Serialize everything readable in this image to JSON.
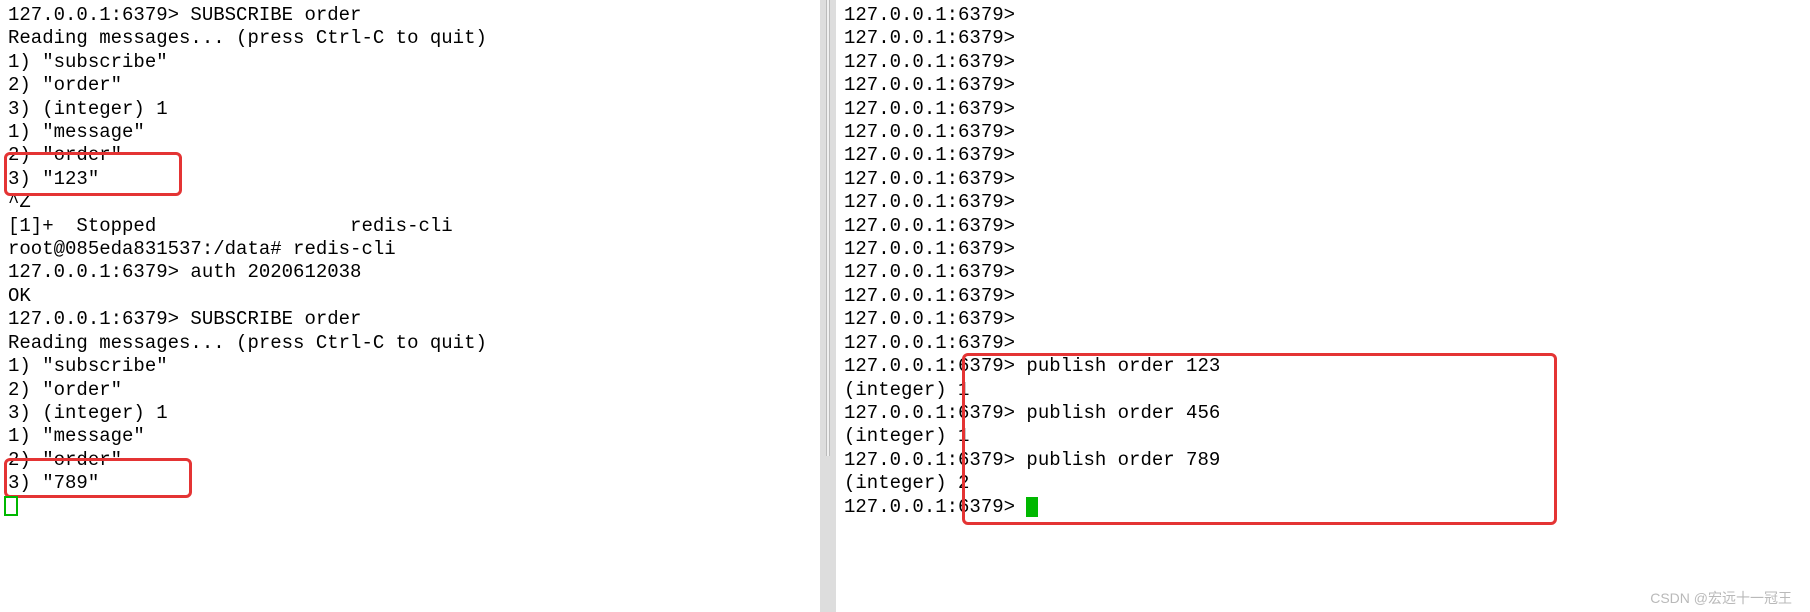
{
  "left": {
    "lines": [
      "127.0.0.1:6379> SUBSCRIBE order",
      "Reading messages... (press Ctrl-C to quit)",
      "1) \"subscribe\"",
      "2) \"order\"",
      "3) (integer) 1",
      "1) \"message\"",
      "2) \"order\"",
      "3) \"123\"",
      "^Z",
      "[1]+  Stopped                 redis-cli",
      "root@085eda831537:/data# redis-cli",
      "127.0.0.1:6379> auth 2020612038",
      "OK",
      "127.0.0.1:6379> SUBSCRIBE order",
      "Reading messages... (press Ctrl-C to quit)",
      "1) \"subscribe\"",
      "2) \"order\"",
      "3) (integer) 1",
      "1) \"message\"",
      "2) \"order\"",
      "3) \"789\""
    ]
  },
  "right": {
    "lines": [
      "127.0.0.1:6379>",
      "127.0.0.1:6379>",
      "127.0.0.1:6379>",
      "127.0.0.1:6379>",
      "127.0.0.1:6379>",
      "127.0.0.1:6379>",
      "127.0.0.1:6379>",
      "127.0.0.1:6379>",
      "127.0.0.1:6379>",
      "127.0.0.1:6379>",
      "127.0.0.1:6379>",
      "127.0.0.1:6379>",
      "127.0.0.1:6379>",
      "127.0.0.1:6379>",
      "127.0.0.1:6379>",
      "127.0.0.1:6379> publish order 123",
      "(integer) 1",
      "127.0.0.1:6379> publish order 456",
      "(integer) 1",
      "127.0.0.1:6379> publish order 789",
      "(integer) 2",
      "127.0.0.1:6379> "
    ]
  },
  "watermark": "CSDN @宏远十一冠王"
}
